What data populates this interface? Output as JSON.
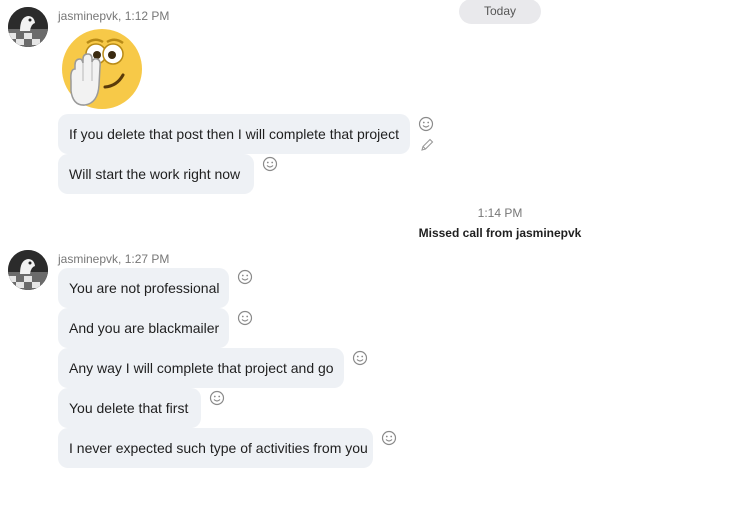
{
  "date_divider": {
    "label": "Today"
  },
  "groups": [
    {
      "sender": "jasminepvk",
      "time": "1:12 PM",
      "emoji": "face-with-hand-over-mouth-emoji",
      "messages": [
        "If you delete that post then I will complete that project",
        "Will start the work right now"
      ]
    },
    {
      "sender": "jasminepvk",
      "time": "1:27 PM",
      "messages": [
        "You are not professional",
        "And you are blackmailer",
        "Any way I will complete that project and go",
        "You delete that first",
        "I never expected such type of activities from you"
      ]
    }
  ],
  "system_event": {
    "time": "1:14 PM",
    "text": "Missed call from jasminepvk"
  },
  "icons": {
    "reaction": "smiley-reaction-icon",
    "edit": "pencil-edit-icon"
  },
  "colors": {
    "bubble": "#eef1f5",
    "pill": "#e9e9ec",
    "emoji_yellow": "#f7c948"
  }
}
